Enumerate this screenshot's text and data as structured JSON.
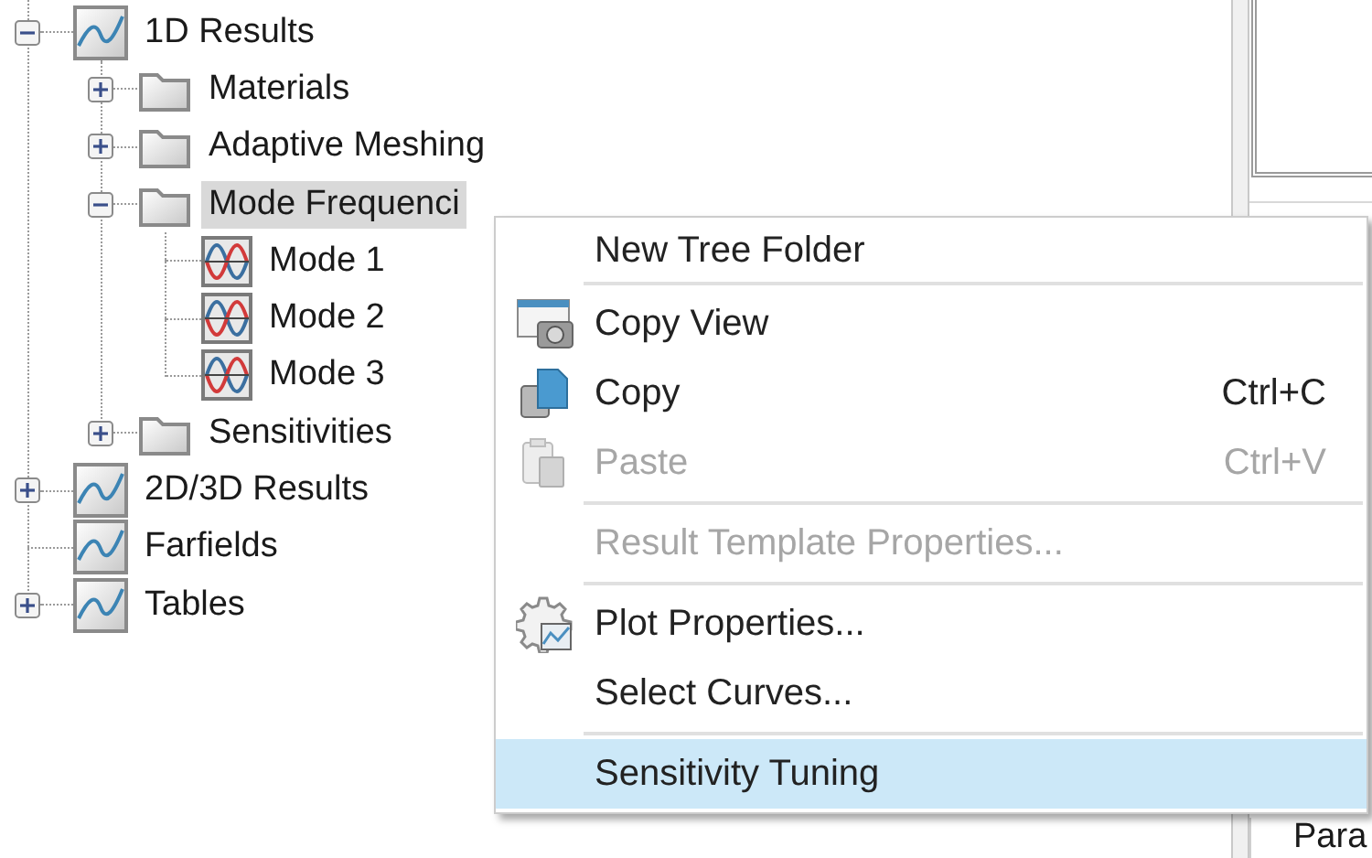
{
  "tree": [
    {
      "label": "1D Results",
      "kind": "results",
      "expanded": true,
      "selected": false,
      "children": [
        {
          "label": "Materials",
          "kind": "folder",
          "expanded": false,
          "selected": false
        },
        {
          "label": "Adaptive Meshing",
          "kind": "folder",
          "expanded": false,
          "selected": false
        },
        {
          "label": "Mode Frequenci",
          "kind": "folder",
          "expanded": true,
          "selected": true,
          "children": [
            {
              "label": "Mode 1",
              "kind": "mode",
              "selected": false
            },
            {
              "label": "Mode 2",
              "kind": "mode",
              "selected": false
            },
            {
              "label": "Mode 3",
              "kind": "mode",
              "selected": false
            }
          ]
        },
        {
          "label": "Sensitivities",
          "kind": "folder",
          "expanded": false,
          "selected": false
        }
      ]
    },
    {
      "label": "2D/3D Results",
      "kind": "results",
      "expanded": false,
      "selected": false
    },
    {
      "label": "Farfields",
      "kind": "results",
      "selected": false
    },
    {
      "label": "Tables",
      "kind": "results",
      "expanded": false,
      "selected": false
    }
  ],
  "context_menu": [
    {
      "kind": "item",
      "label": "New Tree Folder",
      "disabled": false,
      "selected": false
    },
    {
      "kind": "separator"
    },
    {
      "kind": "item",
      "label": "Copy View",
      "disabled": false,
      "selected": false
    },
    {
      "kind": "item",
      "label": "Copy",
      "shortcut": "Ctrl+C",
      "disabled": false,
      "selected": false
    },
    {
      "kind": "item",
      "label": "Paste",
      "shortcut": "Ctrl+V",
      "disabled": true,
      "selected": false
    },
    {
      "kind": "separator"
    },
    {
      "kind": "item",
      "label": "Result Template Properties...",
      "disabled": true,
      "selected": false
    },
    {
      "kind": "separator"
    },
    {
      "kind": "item",
      "label": "Plot Properties...",
      "disabled": false,
      "selected": false
    },
    {
      "kind": "item",
      "label": "Select Curves...",
      "disabled": false,
      "selected": false
    },
    {
      "kind": "separator"
    },
    {
      "kind": "item",
      "label": "Sensitivity Tuning",
      "disabled": false,
      "selected": true
    }
  ],
  "right_panel": {
    "label": "Para"
  }
}
